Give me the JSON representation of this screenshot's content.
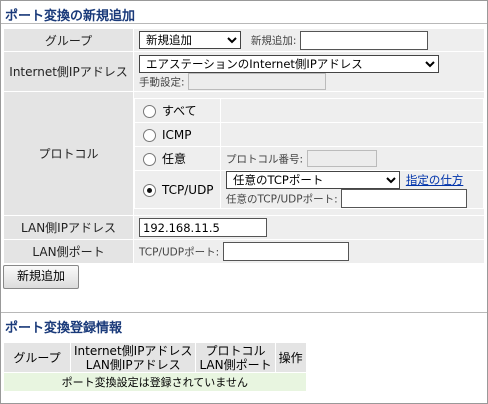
{
  "section1": {
    "title": "ポート変換の新規追加"
  },
  "group": {
    "label": "グループ",
    "select_value": "新規追加",
    "new_label": "新規追加:",
    "new_value": ""
  },
  "internet_ip": {
    "label": "Internet側IPアドレス",
    "select_value": "エアステーションのInternet側IPアドレス",
    "manual_label": "手動設定:",
    "manual_value": ""
  },
  "protocol": {
    "label": "プロトコル",
    "options": [
      {
        "label": "すべて",
        "selected": false
      },
      {
        "label": "ICMP",
        "selected": false
      },
      {
        "label": "任意",
        "selected": false
      },
      {
        "label": "TCP/UDP",
        "selected": true
      }
    ],
    "number_label": "プロトコル番号:",
    "tcp_select_value": "任意のTCPポート",
    "howto_link": "指定の仕方",
    "port_label": "任意のTCP/UDPポート:"
  },
  "lan_ip": {
    "label": "LAN側IPアドレス",
    "value": "192.168.11.5"
  },
  "lan_port": {
    "label": "LAN側ポート",
    "port_label": "TCP/UDPポート:",
    "value": ""
  },
  "add_button": "新規追加",
  "section2": {
    "title": "ポート変換登録情報"
  },
  "list": {
    "headers": {
      "group": "グループ",
      "ip_line1": "Internet側IPアドレス",
      "ip_line2": "LAN側IPアドレス",
      "proto_line1": "プロトコル",
      "proto_line2": "LAN側ポート",
      "action": "操作"
    },
    "empty": "ポート変換設定は登録されていません"
  }
}
